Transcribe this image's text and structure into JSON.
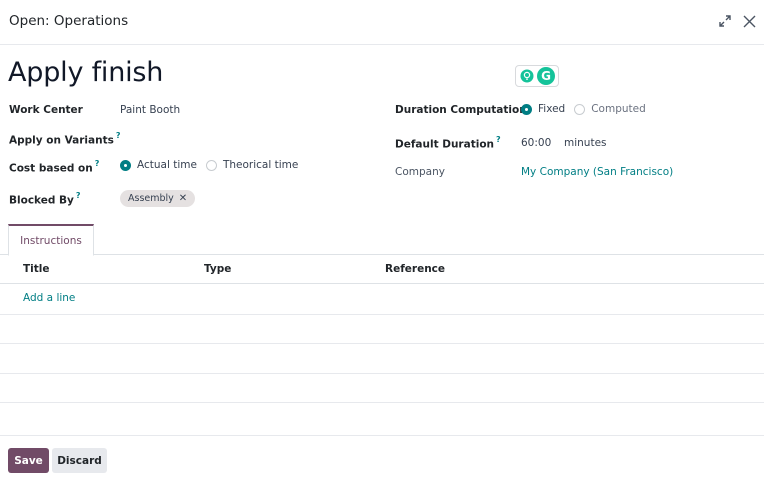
{
  "dialog": {
    "title": "Open: Operations"
  },
  "record": {
    "name": "Apply finish"
  },
  "fields": {
    "work_center": {
      "label": "Work Center",
      "value": "Paint Booth"
    },
    "apply_on_variants": {
      "label": "Apply on Variants",
      "help": "?"
    },
    "cost_based_on": {
      "label": "Cost based on",
      "help": "?",
      "options": [
        "Actual time",
        "Theorical time"
      ],
      "selected": "Actual time"
    },
    "blocked_by": {
      "label": "Blocked By",
      "help": "?",
      "tags": [
        "Assembly"
      ]
    },
    "duration_computation": {
      "label": "Duration Computation",
      "options": [
        "Fixed",
        "Computed"
      ],
      "selected": "Fixed"
    },
    "default_duration": {
      "label": "Default Duration",
      "help": "?",
      "value": "60:00",
      "unit": "minutes"
    },
    "company": {
      "label": "Company",
      "value": "My Company (San Francisco)"
    }
  },
  "tabs": [
    {
      "label": "Instructions",
      "active": true
    }
  ],
  "table": {
    "columns": [
      "Title",
      "Type",
      "Reference"
    ],
    "add_line": "Add a line"
  },
  "footer": {
    "save_label": "Save",
    "discard_label": "Discard"
  },
  "colors": {
    "primary": "#714b67",
    "accent": "#017e84"
  }
}
